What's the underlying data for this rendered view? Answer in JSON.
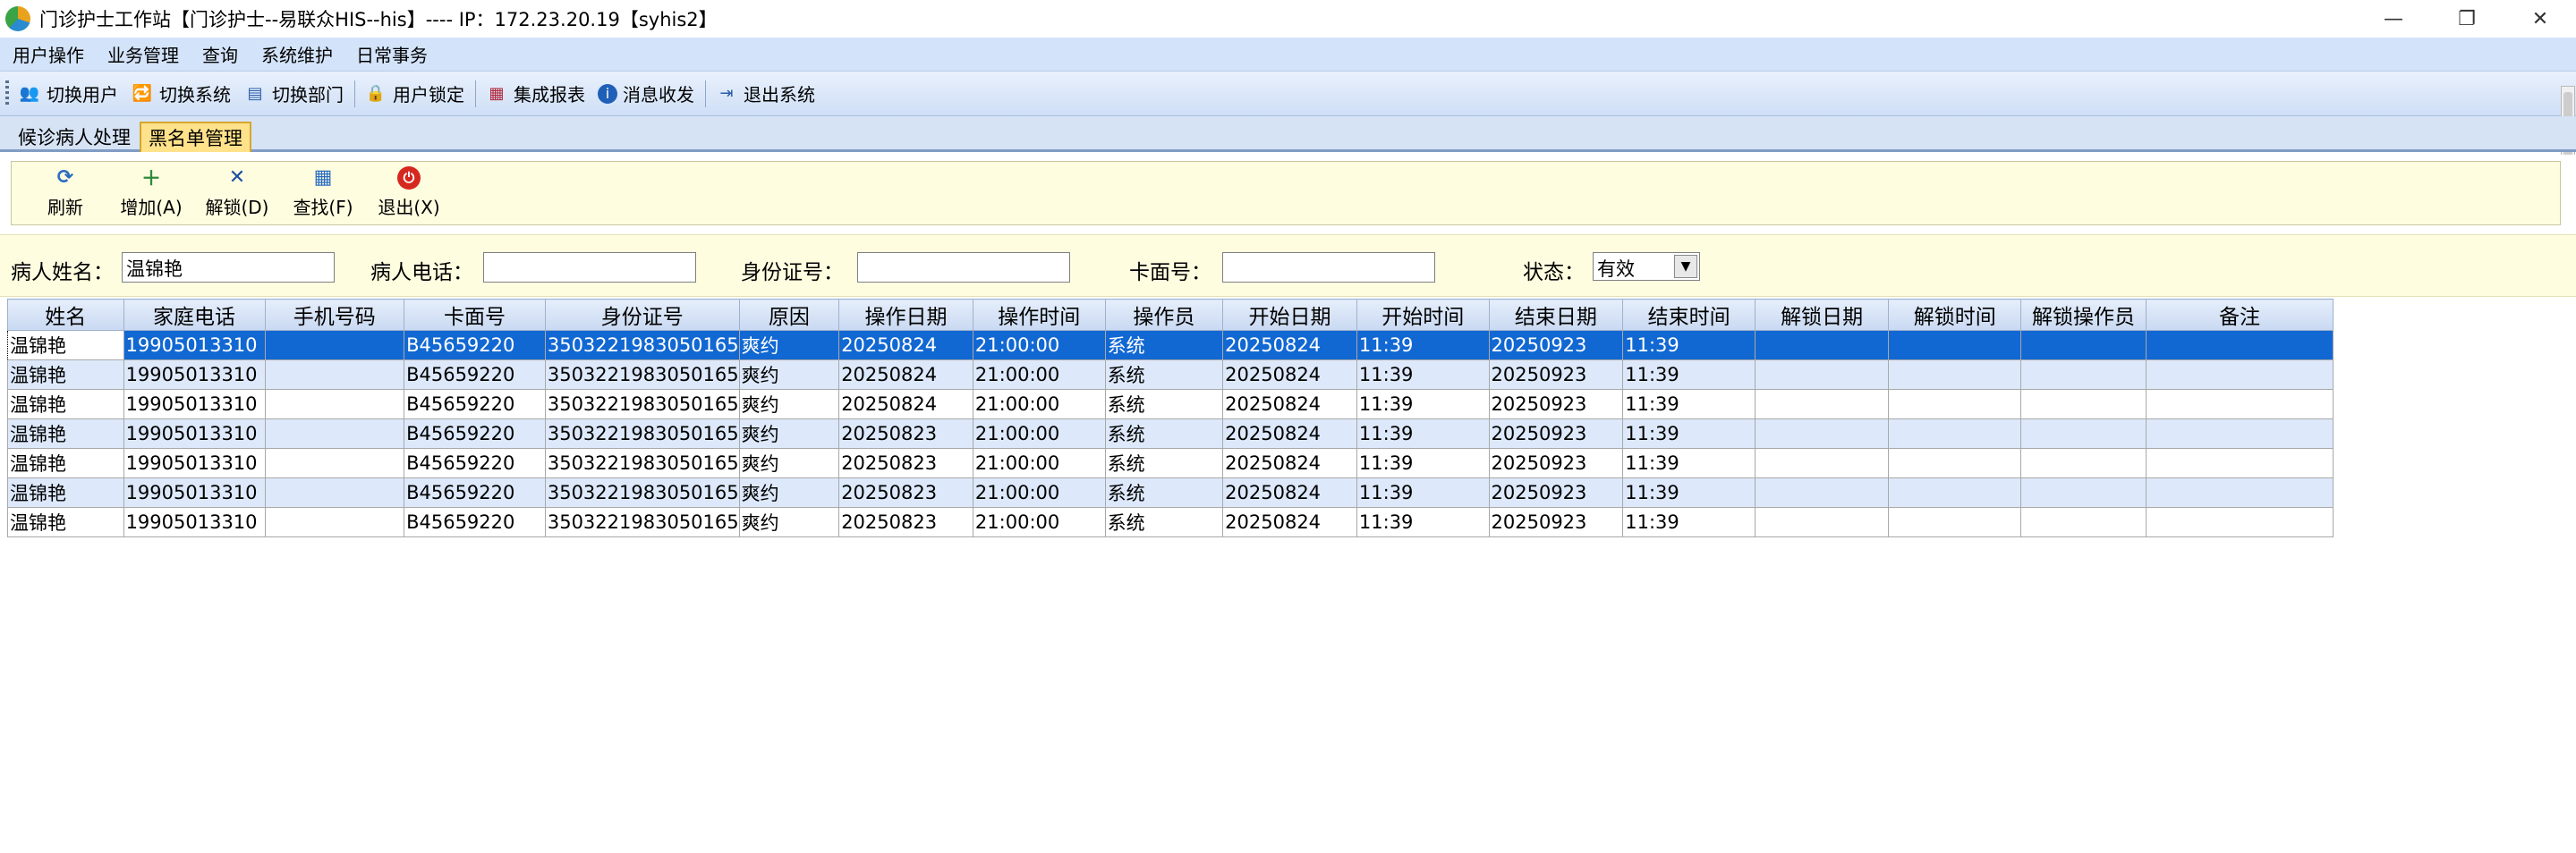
{
  "window": {
    "title": "门诊护士工作站【门诊护士--易联众HIS--his】---- IP：172.23.20.19【syhis2】",
    "controls": {
      "minimize": "—",
      "restore": "❐",
      "close": "✕"
    }
  },
  "menubar": {
    "items": [
      "用户操作",
      "业务管理",
      "查询",
      "系统维护",
      "日常事务"
    ]
  },
  "toolbar": {
    "items": [
      {
        "label": "切换用户",
        "icon": "switch-user-icon"
      },
      {
        "label": "切换系统",
        "icon": "switch-system-icon"
      },
      {
        "label": "切换部门",
        "icon": "switch-dept-icon"
      },
      {
        "label": "用户锁定",
        "icon": "user-lock-icon"
      },
      {
        "label": "集成报表",
        "icon": "report-icon"
      },
      {
        "label": "消息收发",
        "icon": "info-icon"
      },
      {
        "label": "退出系统",
        "icon": "exit-icon"
      }
    ]
  },
  "tabs": [
    {
      "label": "候诊病人处理",
      "active": false
    },
    {
      "label": "黑名单管理",
      "active": true
    }
  ],
  "actions": [
    {
      "label": "刷新",
      "icon": "refresh-icon"
    },
    {
      "label": "增加(A)",
      "icon": "add-icon"
    },
    {
      "label": "解锁(D)",
      "icon": "unlock-icon"
    },
    {
      "label": "查找(F)",
      "icon": "find-icon"
    },
    {
      "label": "退出(X)",
      "icon": "power-icon"
    }
  ],
  "search": {
    "name_label": "病人姓名：",
    "name_value": "温锦艳",
    "phone_label": "病人电话：",
    "phone_value": "",
    "id_label": "身份证号：",
    "id_value": "",
    "card_label": "卡面号：",
    "card_value": "",
    "status_label": "状态：",
    "status_value": "有效"
  },
  "grid": {
    "columns": [
      "姓名",
      "家庭电话",
      "手机号码",
      "卡面号",
      "身份证号",
      "原因",
      "操作日期",
      "操作时间",
      "操作员",
      "开始日期",
      "开始时间",
      "结束日期",
      "结束时间",
      "解锁日期",
      "解锁时间",
      "解锁操作员",
      "备注"
    ],
    "rows": [
      [
        "温锦艳",
        "19905013310",
        "",
        "B45659220",
        "3503221983050165",
        "爽约",
        "20250824",
        "21:00:00",
        "系统",
        "20250824",
        "11:39",
        "20250923",
        "11:39",
        "",
        "",
        "",
        ""
      ],
      [
        "温锦艳",
        "19905013310",
        "",
        "B45659220",
        "3503221983050165",
        "爽约",
        "20250824",
        "21:00:00",
        "系统",
        "20250824",
        "11:39",
        "20250923",
        "11:39",
        "",
        "",
        "",
        ""
      ],
      [
        "温锦艳",
        "19905013310",
        "",
        "B45659220",
        "3503221983050165",
        "爽约",
        "20250824",
        "21:00:00",
        "系统",
        "20250824",
        "11:39",
        "20250923",
        "11:39",
        "",
        "",
        "",
        ""
      ],
      [
        "温锦艳",
        "19905013310",
        "",
        "B45659220",
        "3503221983050165",
        "爽约",
        "20250823",
        "21:00:00",
        "系统",
        "20250824",
        "11:39",
        "20250923",
        "11:39",
        "",
        "",
        "",
        ""
      ],
      [
        "温锦艳",
        "19905013310",
        "",
        "B45659220",
        "3503221983050165",
        "爽约",
        "20250823",
        "21:00:00",
        "系统",
        "20250824",
        "11:39",
        "20250923",
        "11:39",
        "",
        "",
        "",
        ""
      ],
      [
        "温锦艳",
        "19905013310",
        "",
        "B45659220",
        "3503221983050165",
        "爽约",
        "20250823",
        "21:00:00",
        "系统",
        "20250824",
        "11:39",
        "20250923",
        "11:39",
        "",
        "",
        "",
        ""
      ],
      [
        "温锦艳",
        "19905013310",
        "",
        "B45659220",
        "3503221983050165",
        "爽约",
        "20250823",
        "21:00:00",
        "系统",
        "20250824",
        "11:39",
        "20250923",
        "11:39",
        "",
        "",
        "",
        ""
      ]
    ],
    "selected_row": 0
  },
  "colors": {
    "selection": "#1268d2",
    "alt_row": "#dde9fb",
    "menubar": "#d3e3f9",
    "panel": "#fffde0",
    "active_tab": "#ffe28a"
  }
}
